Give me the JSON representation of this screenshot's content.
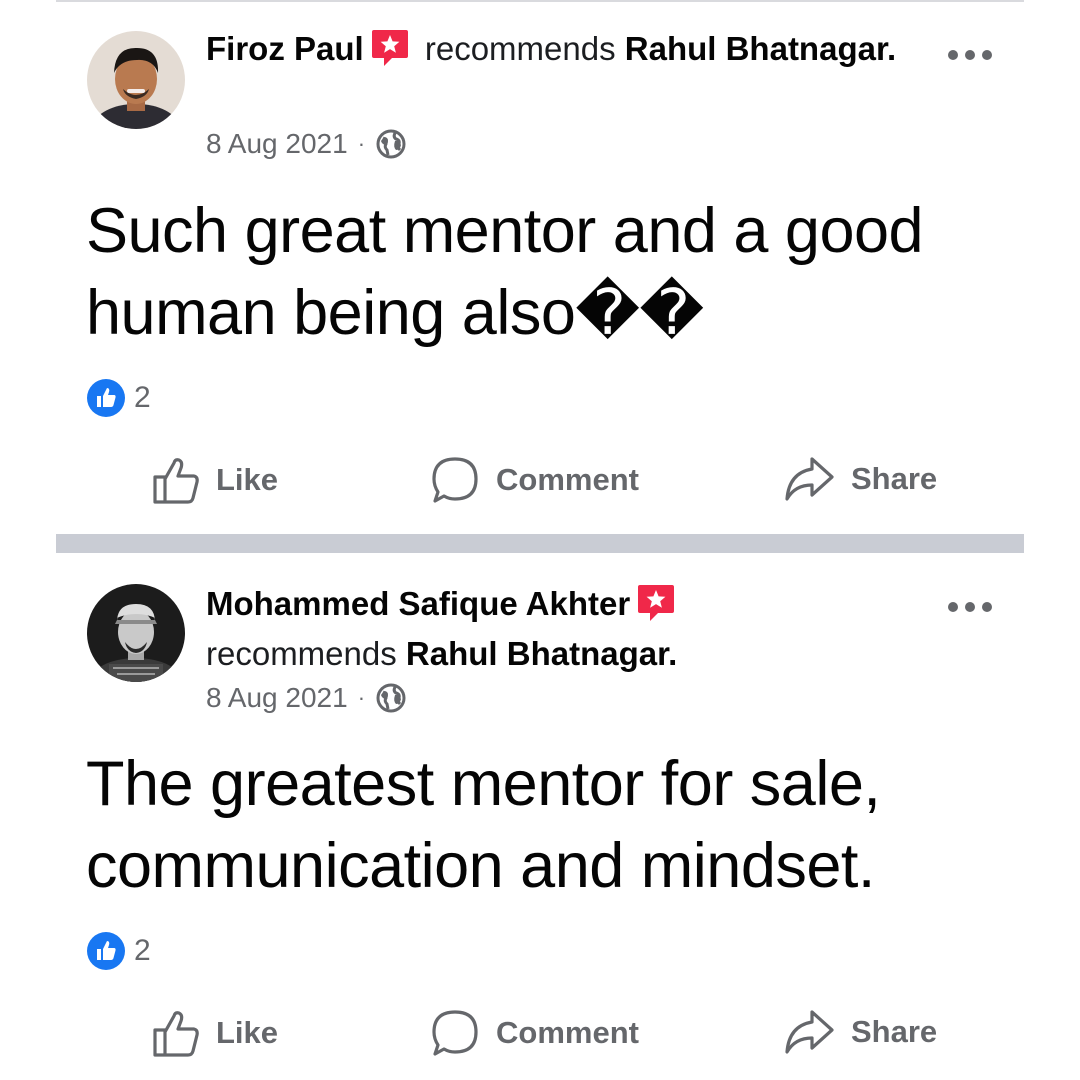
{
  "posts": [
    {
      "author": "Firoz Paul",
      "verb": "recommends",
      "target": "Rahul Bhatnagar.",
      "date": "8 Aug 2021",
      "separator": "·",
      "text": "Such great mentor and a good human being also��",
      "reaction_count": "2",
      "actions": {
        "like": "Like",
        "comment": "Comment",
        "share": "Share"
      }
    },
    {
      "author": "Mohammed Safique Akhter",
      "verb": "recommends",
      "target": "Rahul Bhatnagar.",
      "date": "8 Aug 2021",
      "separator": "·",
      "text": "The greatest mentor for sale, communication and mindset.",
      "reaction_count": "2",
      "actions": {
        "like": "Like",
        "comment": "Comment",
        "share": "Share"
      }
    }
  ],
  "icons": {
    "recommend": "recommend-star-icon",
    "audience": "globe-icon",
    "reaction": "like-reaction-icon",
    "more": "more-options-icon"
  },
  "colors": {
    "recommend_badge": "#f02849",
    "like_blue": "#1877f2",
    "secondary_text": "#65676b",
    "divider": "#c9ccd4"
  }
}
